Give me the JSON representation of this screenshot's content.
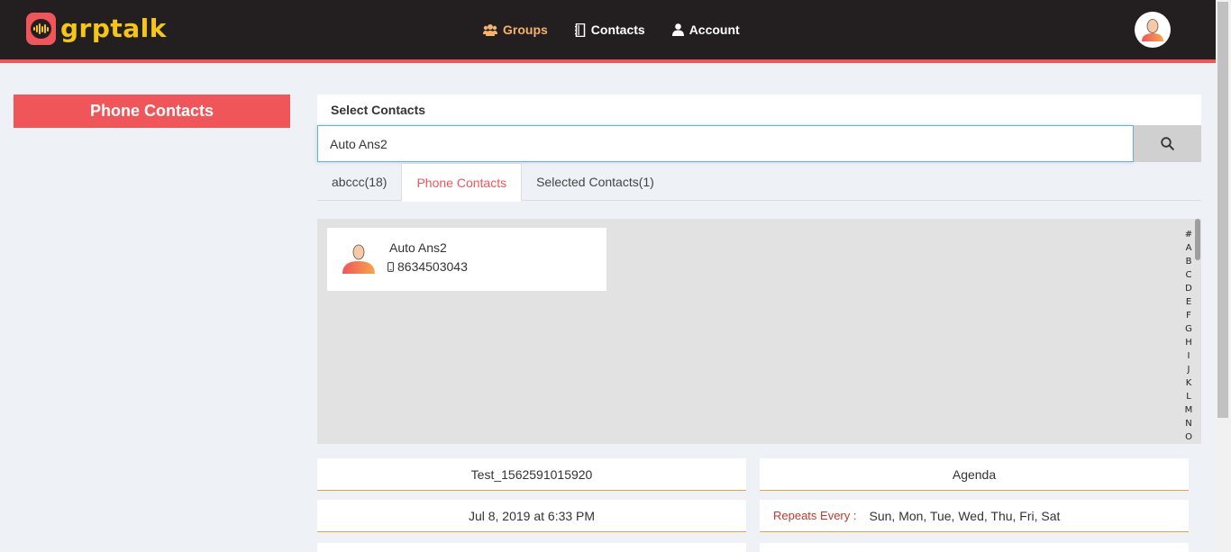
{
  "header": {
    "logo_text": "grptalk",
    "nav": [
      {
        "label": "Groups",
        "icon": "users-icon",
        "active": true
      },
      {
        "label": "Contacts",
        "icon": "address-book-icon",
        "active": false
      },
      {
        "label": "Account",
        "icon": "user-icon",
        "active": false
      }
    ],
    "accent_color": "#f0555a",
    "brand_color": "#f6c614"
  },
  "sidebar": {
    "title": "Phone Contacts"
  },
  "main": {
    "select_label": "Select Contacts",
    "search": {
      "value": "Auto Ans2",
      "placeholder": ""
    },
    "tabs": [
      {
        "label": "abccc(18)",
        "active": false
      },
      {
        "label": "Phone Contacts",
        "active": true
      },
      {
        "label": "Selected Contacts(1)",
        "active": false
      }
    ],
    "contacts": [
      {
        "name": "Auto Ans2",
        "phone": "8634503043"
      }
    ],
    "alphabet": [
      "#",
      "A",
      "B",
      "C",
      "D",
      "E",
      "F",
      "G",
      "H",
      "I",
      "J",
      "K",
      "L",
      "M",
      "N",
      "O"
    ]
  },
  "details": {
    "group_name": "Test_1562591015920",
    "agenda": "Agenda",
    "schedule": "Jul 8, 2019 at 6:33 PM",
    "repeats_label": "Repeats Every :",
    "repeats_days": "Sun, Mon, Tue, Wed, Thu, Fri, Sat"
  }
}
